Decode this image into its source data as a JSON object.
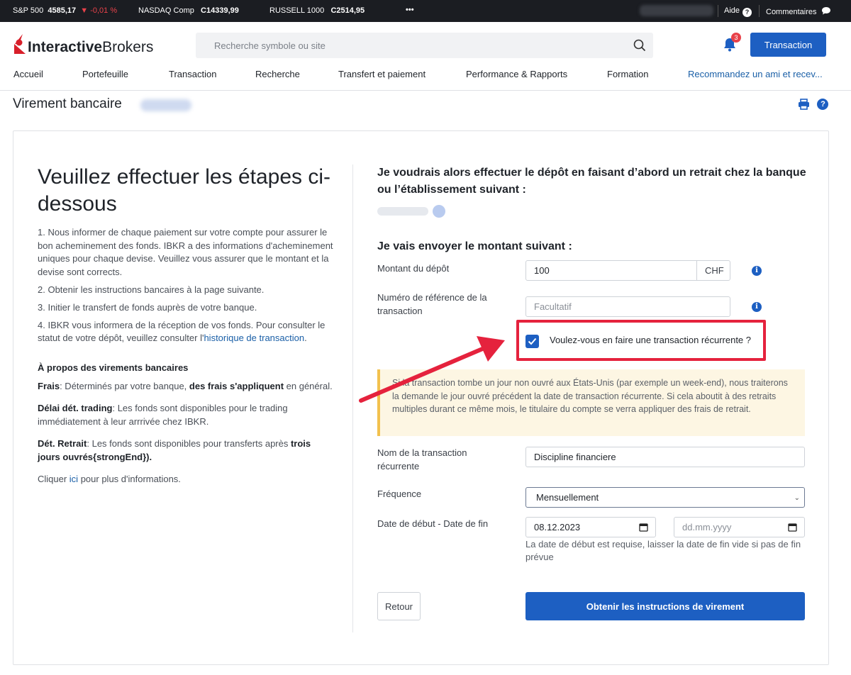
{
  "ticker": {
    "sp500_label": "S&P 500",
    "sp500_value": "4585,17",
    "sp500_change": "▼ -0,01 %",
    "nasdaq_label": "NASDAQ Comp",
    "nasdaq_value": "C14339,99",
    "russell_label": "RUSSELL 1000",
    "russell_value": "C2514,95",
    "more": "•••",
    "help": "Aide",
    "comments": "Commentaires"
  },
  "header": {
    "logo_bold": "Interactive",
    "logo_light": "Brokers",
    "search_placeholder": "Recherche symbole ou site",
    "notification_count": "3",
    "transaction_button": "Transaction"
  },
  "nav": [
    "Accueil",
    "Portefeuille",
    "Transaction",
    "Recherche",
    "Transfert et paiement",
    "Performance & Rapports",
    "Formation",
    "Recommandez un ami et recev..."
  ],
  "page": {
    "title": "Virement bancaire"
  },
  "left": {
    "heading": "Veuillez effectuer les étapes ci-dessous",
    "step1": "1. Nous informer de chaque paiement sur votre compte pour assurer le bon acheminement des fonds. IBKR a des informations d'acheminement uniques pour chaque devise. Veuillez vous assurer que le montant et la devise sont corrects.",
    "step2": "2. Obtenir les instructions bancaires à la page suivante.",
    "step3": "3. Initier le transfert de fonds auprès de votre banque.",
    "step4_pre": "4. IBKR vous informera de la réception de vos fonds. Pour consulter le statut de votre dépôt, veuillez consulter l'",
    "step4_link": "historique de transaction",
    "step4_post": ".",
    "about_title": "À propos des virements bancaires",
    "fees_label": "Frais",
    "fees_text1": ": Déterminés par votre banque, ",
    "fees_bold": "des frais s'appliquent",
    "fees_text2": " en général.",
    "delay_label": "Délai dét. trading",
    "delay_text": ": Les fonds sont disponibles pour le trading immédiatement à leur arrrivée chez IBKR.",
    "withdraw_label": "Dét. Retrait",
    "withdraw_text": ": Les fonds sont disponibles pour transferts après ",
    "withdraw_bold": "trois jours ouvrés{strongEnd}).",
    "click_pre": "Cliquer ",
    "click_link": "ici",
    "click_post": " pour plus d'informations."
  },
  "right": {
    "deposit_heading": "Je voudrais alors effectuer le dépôt en faisant d’abord un retrait chez la banque ou l’établissement suivant :",
    "amount_heading": "Je vais envoyer le montant suivant :",
    "amount_label": "Montant du dépôt",
    "amount_value": "100",
    "currency": "CHF",
    "ref_label": "Numéro de référence de la transaction",
    "ref_placeholder": "Facultatif",
    "recurring_label": "Voulez-vous en faire une transaction récurrente ?",
    "recurring_checked": true,
    "warning": "Si la transaction tombe un jour non ouvré aux États-Unis (par exemple un week-end), nous traiterons la demande le jour ouvré précédent la date de transaction récurrente. Si cela aboutit à des retraits multiples durant ce même mois, le titulaire du compte se verra appliquer des frais de retrait.",
    "name_label": "Nom de la transaction récurrente",
    "name_value": "Discipline financiere",
    "freq_label": "Fréquence",
    "freq_value": "Mensuellement",
    "dates_label": "Date de début - Date de fin",
    "start_date": "08.12.2023",
    "end_date_placeholder": "dd.mm.yyyy",
    "dates_hint": "La date de début est requise, laisser la date de fin vide si pas de fin prévue",
    "back_button": "Retour",
    "submit_button": "Obtenir les instructions de virement"
  },
  "colors": {
    "primary": "#1d5fc2",
    "highlight": "#e5223d",
    "warning_bg": "#fdf6e3",
    "warning_border": "#f2c14e"
  }
}
